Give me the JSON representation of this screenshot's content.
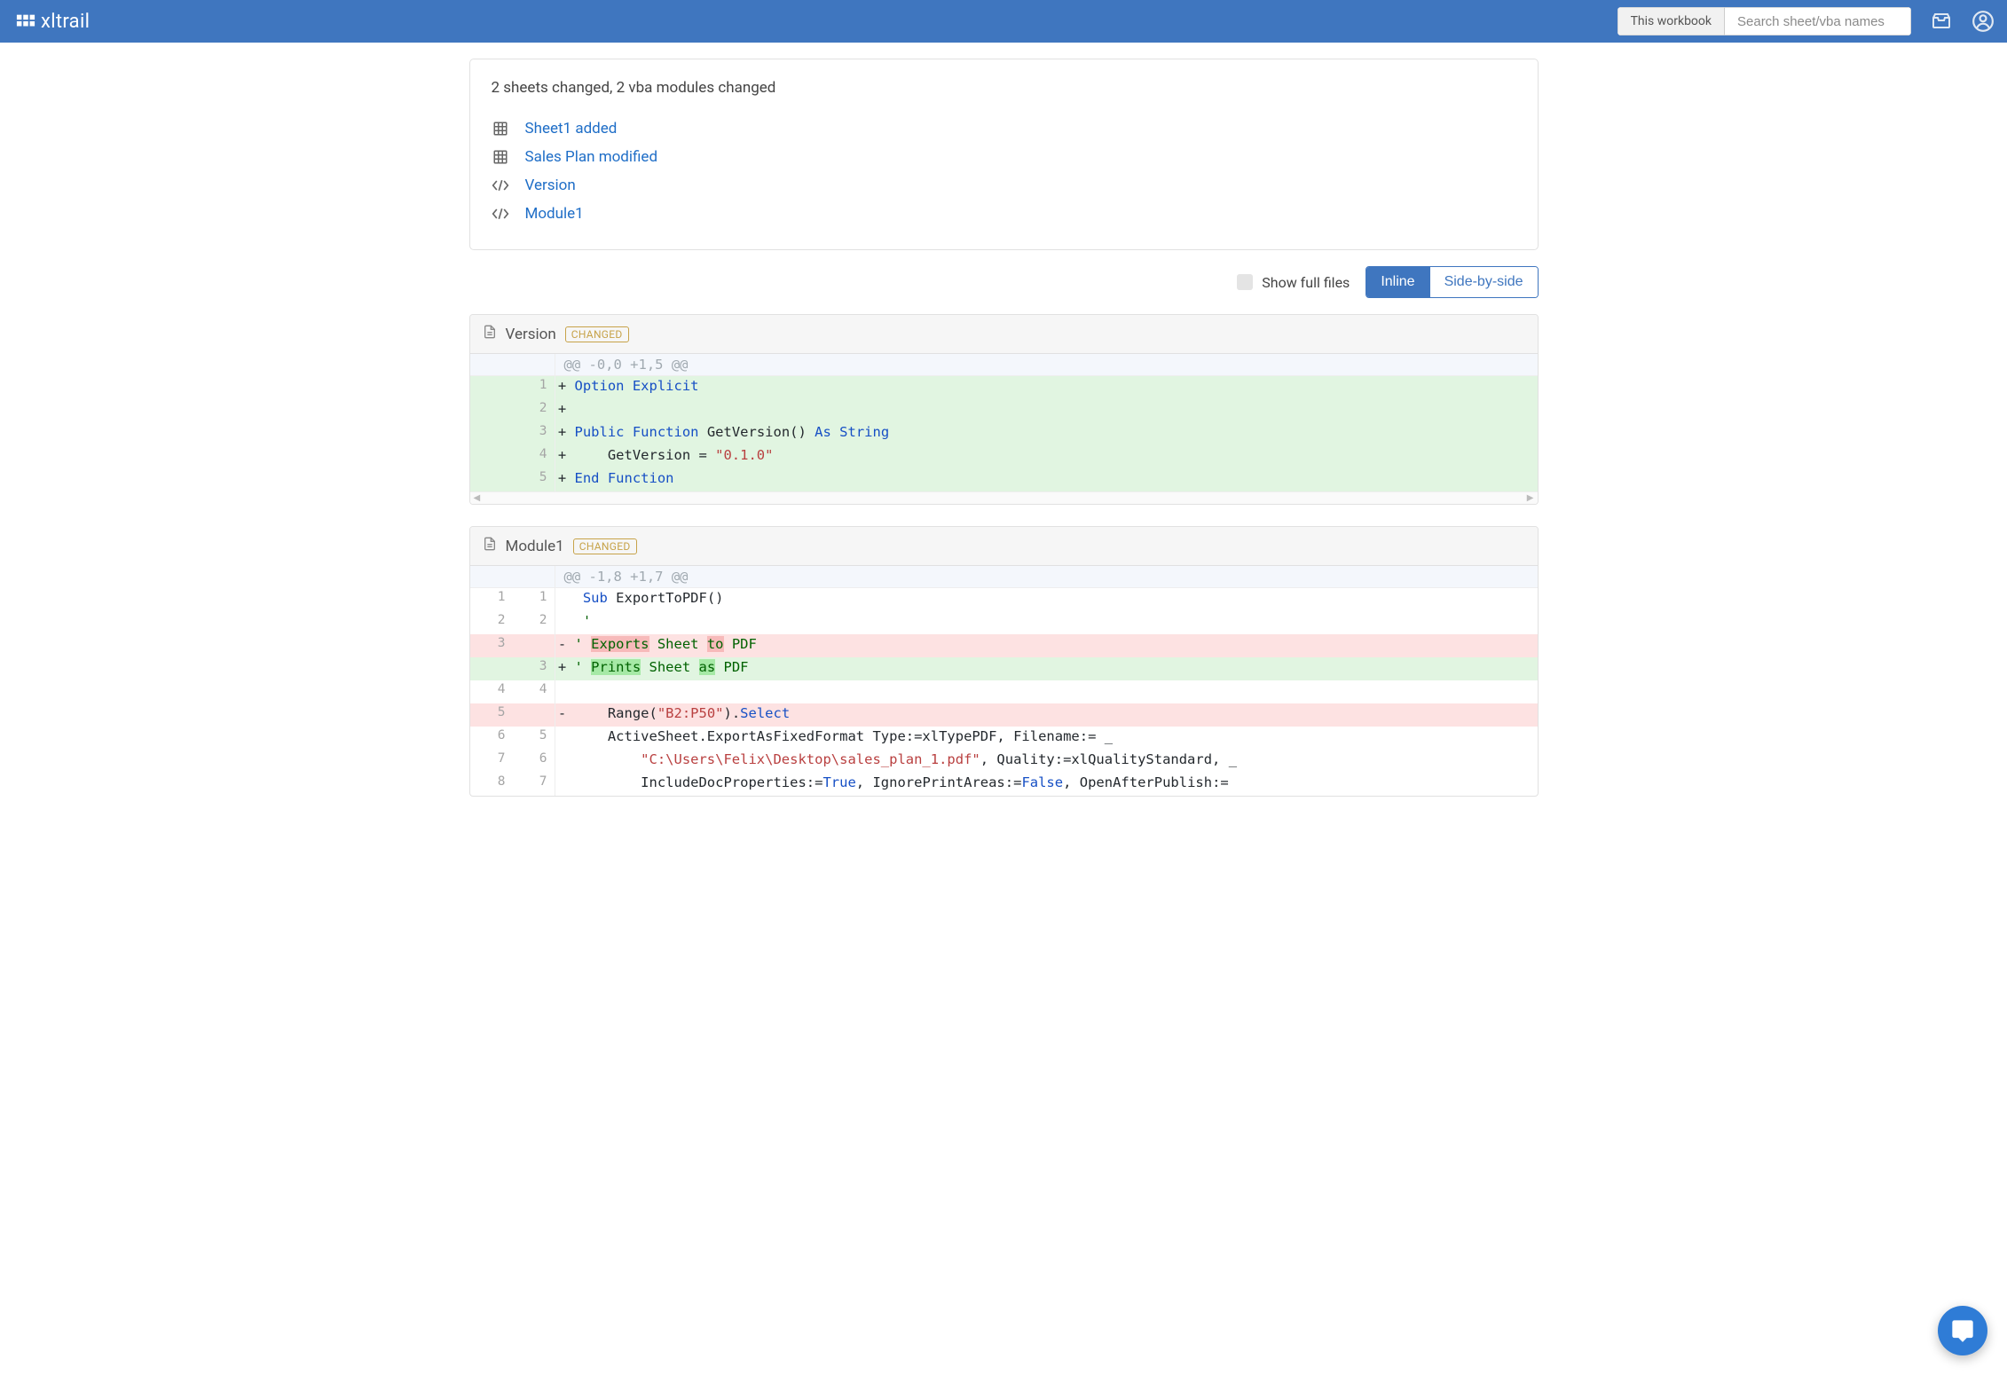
{
  "header": {
    "brand": "xltrail",
    "search_scope": "This workbook",
    "search_placeholder": "Search sheet/vba names"
  },
  "summary": {
    "title": "2 sheets changed, 2 vba modules changed",
    "items": [
      {
        "icon": "sheet",
        "label": "Sheet1 added"
      },
      {
        "icon": "sheet",
        "label": "Sales Plan modified"
      },
      {
        "icon": "code",
        "label": "Version"
      },
      {
        "icon": "code",
        "label": "Module1"
      }
    ]
  },
  "toolbar": {
    "show_full_files": "Show full files",
    "inline": "Inline",
    "side_by_side": "Side-by-side"
  },
  "panels": [
    {
      "title": "Version",
      "badge": "CHANGED",
      "hunk": "@@ -0,0 +1,5 @@",
      "rows": [
        {
          "type": "add",
          "old": "",
          "new": "1",
          "tokens": [
            {
              "t": "Option",
              "c": "kw"
            },
            {
              "t": " "
            },
            {
              "t": "Explicit",
              "c": "kw"
            }
          ]
        },
        {
          "type": "add",
          "old": "",
          "new": "2",
          "tokens": []
        },
        {
          "type": "add",
          "old": "",
          "new": "3",
          "tokens": [
            {
              "t": "Public",
              "c": "kw"
            },
            {
              "t": " "
            },
            {
              "t": "Function",
              "c": "kw"
            },
            {
              "t": " GetVersion() "
            },
            {
              "t": "As",
              "c": "kw"
            },
            {
              "t": " "
            },
            {
              "t": "String",
              "c": "kw"
            }
          ]
        },
        {
          "type": "add",
          "old": "",
          "new": "4",
          "tokens": [
            {
              "t": "    GetVersion = "
            },
            {
              "t": "\"0.1.0\"",
              "c": "str"
            }
          ]
        },
        {
          "type": "add",
          "old": "",
          "new": "5",
          "tokens": [
            {
              "t": "End",
              "c": "kw"
            },
            {
              "t": " "
            },
            {
              "t": "Function",
              "c": "kw"
            }
          ]
        }
      ],
      "scroll": true
    },
    {
      "title": "Module1",
      "badge": "CHANGED",
      "hunk": "@@ -1,8 +1,7 @@",
      "rows": [
        {
          "type": "ctx",
          "old": "1",
          "new": "1",
          "tokens": [
            {
              "t": " "
            },
            {
              "t": "Sub",
              "c": "kw"
            },
            {
              "t": " ExportToPDF()"
            }
          ]
        },
        {
          "type": "ctx",
          "old": "2",
          "new": "2",
          "tokens": [
            {
              "t": " "
            },
            {
              "t": "'",
              "c": "cmt"
            }
          ]
        },
        {
          "type": "del",
          "old": "3",
          "new": "",
          "tokens": [
            {
              "t": "' ",
              "c": "cmt"
            },
            {
              "t": "Exports",
              "c": "cmt",
              "hl": "del"
            },
            {
              "t": " Sheet ",
              "c": "cmt"
            },
            {
              "t": "to",
              "c": "cmt",
              "hl": "del"
            },
            {
              "t": " PDF",
              "c": "cmt"
            }
          ]
        },
        {
          "type": "add",
          "old": "",
          "new": "3",
          "tokens": [
            {
              "t": "' ",
              "c": "cmt"
            },
            {
              "t": "Prints",
              "c": "cmt",
              "hl": "add"
            },
            {
              "t": " Sheet ",
              "c": "cmt"
            },
            {
              "t": "as",
              "c": "cmt",
              "hl": "add"
            },
            {
              "t": " PDF",
              "c": "cmt"
            }
          ]
        },
        {
          "type": "ctx",
          "old": "4",
          "new": "4",
          "tokens": []
        },
        {
          "type": "del",
          "old": "5",
          "new": "",
          "tokens": [
            {
              "t": "    Range("
            },
            {
              "t": "\"B2:P50\"",
              "c": "str"
            },
            {
              "t": ")."
            },
            {
              "t": "Select",
              "c": "fn"
            }
          ]
        },
        {
          "type": "ctx",
          "old": "6",
          "new": "5",
          "tokens": [
            {
              "t": "    ActiveSheet.ExportAsFixedFormat Type:=xlTypePDF, Filename:= _"
            }
          ]
        },
        {
          "type": "ctx",
          "old": "7",
          "new": "6",
          "tokens": [
            {
              "t": "        "
            },
            {
              "t": "\"C:\\Users\\Felix\\Desktop\\sales_plan_1.pdf\"",
              "c": "str"
            },
            {
              "t": ", Quality:=xlQualityStandard, _"
            }
          ]
        },
        {
          "type": "ctx",
          "old": "8",
          "new": "7",
          "tokens": [
            {
              "t": "        IncludeDocProperties:="
            },
            {
              "t": "True",
              "c": "kw"
            },
            {
              "t": ", IgnorePrintAreas:="
            },
            {
              "t": "False",
              "c": "kw"
            },
            {
              "t": ", OpenAfterPublish:= "
            }
          ]
        }
      ],
      "scroll": false
    }
  ]
}
